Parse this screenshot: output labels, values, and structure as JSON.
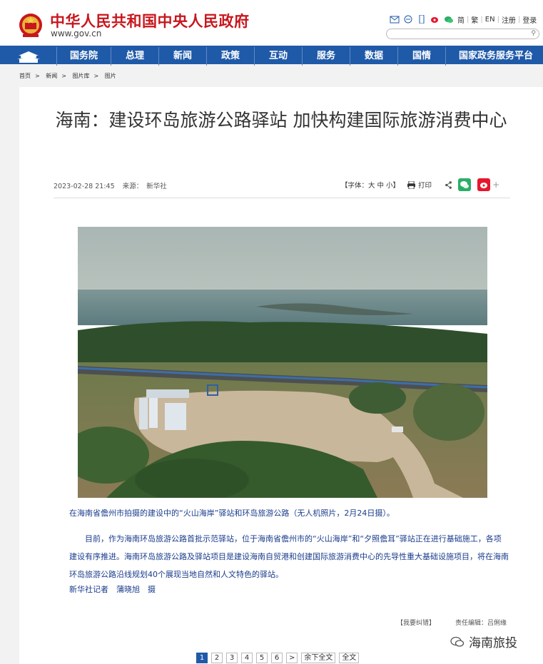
{
  "header": {
    "site_title": "中华人民共和国中央人民政府",
    "site_url": "www.gov.cn",
    "tools": [
      "简",
      "繁",
      "EN",
      "注册",
      "登录"
    ]
  },
  "nav": {
    "items": [
      "国务院",
      "总理",
      "新闻",
      "政策",
      "互动",
      "服务",
      "数据",
      "国情",
      "国家政务服务平台"
    ]
  },
  "breadcrumb": [
    "首页",
    "新闻",
    "图片库",
    "图片"
  ],
  "article": {
    "title": "海南：建设环岛旅游公路驿站 加快构建国际旅游消费中心",
    "date": "2023-02-28 21:45",
    "source_label": "来源：",
    "source": "新华社",
    "font_size_label": "【字体：大 中 小】",
    "print_label": "打印",
    "caption": "在海南省儋州市拍摄的建设中的“火山海岸”驿站和环岛旅游公路（无人机照片，2月24日摄）。",
    "paragraph": "目前，作为海南环岛旅游公路首批示范驿站，位于海南省儋州市的“火山海岸”和“夕照儋耳”驿站正在进行基础施工，各项建设有序推进。海南环岛旅游公路及驿站项目是建设海南自贸港和创建国际旅游消费中心的先导性重大基础设施项目，将在海南环岛旅游公路沿线规划40个展现当地自然和人文特色的驿站。",
    "credit": "新华社记者　蒲晓旭　摄",
    "report_error": "【我要纠错】",
    "editor": "责任编辑：吕俐缘"
  },
  "watermark": "海南旅投",
  "pagination": {
    "pages": [
      "1",
      "2",
      "3",
      "4",
      "5",
      "6"
    ],
    "next": ">",
    "rest_all": "余下全文",
    "full_text": "全文",
    "current": "1"
  },
  "colors": {
    "brand_red": "#c8161d",
    "nav_blue": "#1f5aa8",
    "text_blue": "#1a3c8c"
  }
}
